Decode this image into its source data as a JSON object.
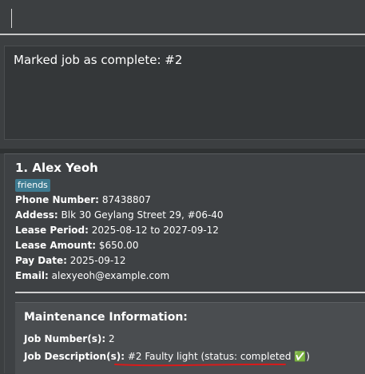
{
  "command": {
    "value": "",
    "placeholder": ""
  },
  "result": {
    "message": "Marked job as complete: #2"
  },
  "person": {
    "index_name": "1. Alex Yeoh",
    "tag": "friends",
    "phone_label": "Phone Number:",
    "phone_value": "87438807",
    "address_label": "Addess:",
    "address_value": "Blk 30 Geylang Street 29, #06-40",
    "lease_period_label": "Lease Period:",
    "lease_period_value": "2025-08-12 to 2027-09-12",
    "lease_amount_label": "Lease Amount:",
    "lease_amount_value": "$650.00",
    "pay_date_label": "Pay Date:",
    "pay_date_value": "2025-09-12",
    "email_label": "Email:",
    "email_value": "alexyeoh@example.com"
  },
  "maintenance": {
    "title": "Maintenance Information:",
    "job_numbers_label": "Job Number(s):",
    "job_numbers_value": "2",
    "job_description_label": "Job Description(s):",
    "job_description_value": "#2 Faulty light (status: completed ✅)",
    "annotation_color": "#d81b1b"
  },
  "colors": {
    "background": "#3c3f41",
    "tag_background": "#3e7b91",
    "card_background": "#3e4144"
  }
}
